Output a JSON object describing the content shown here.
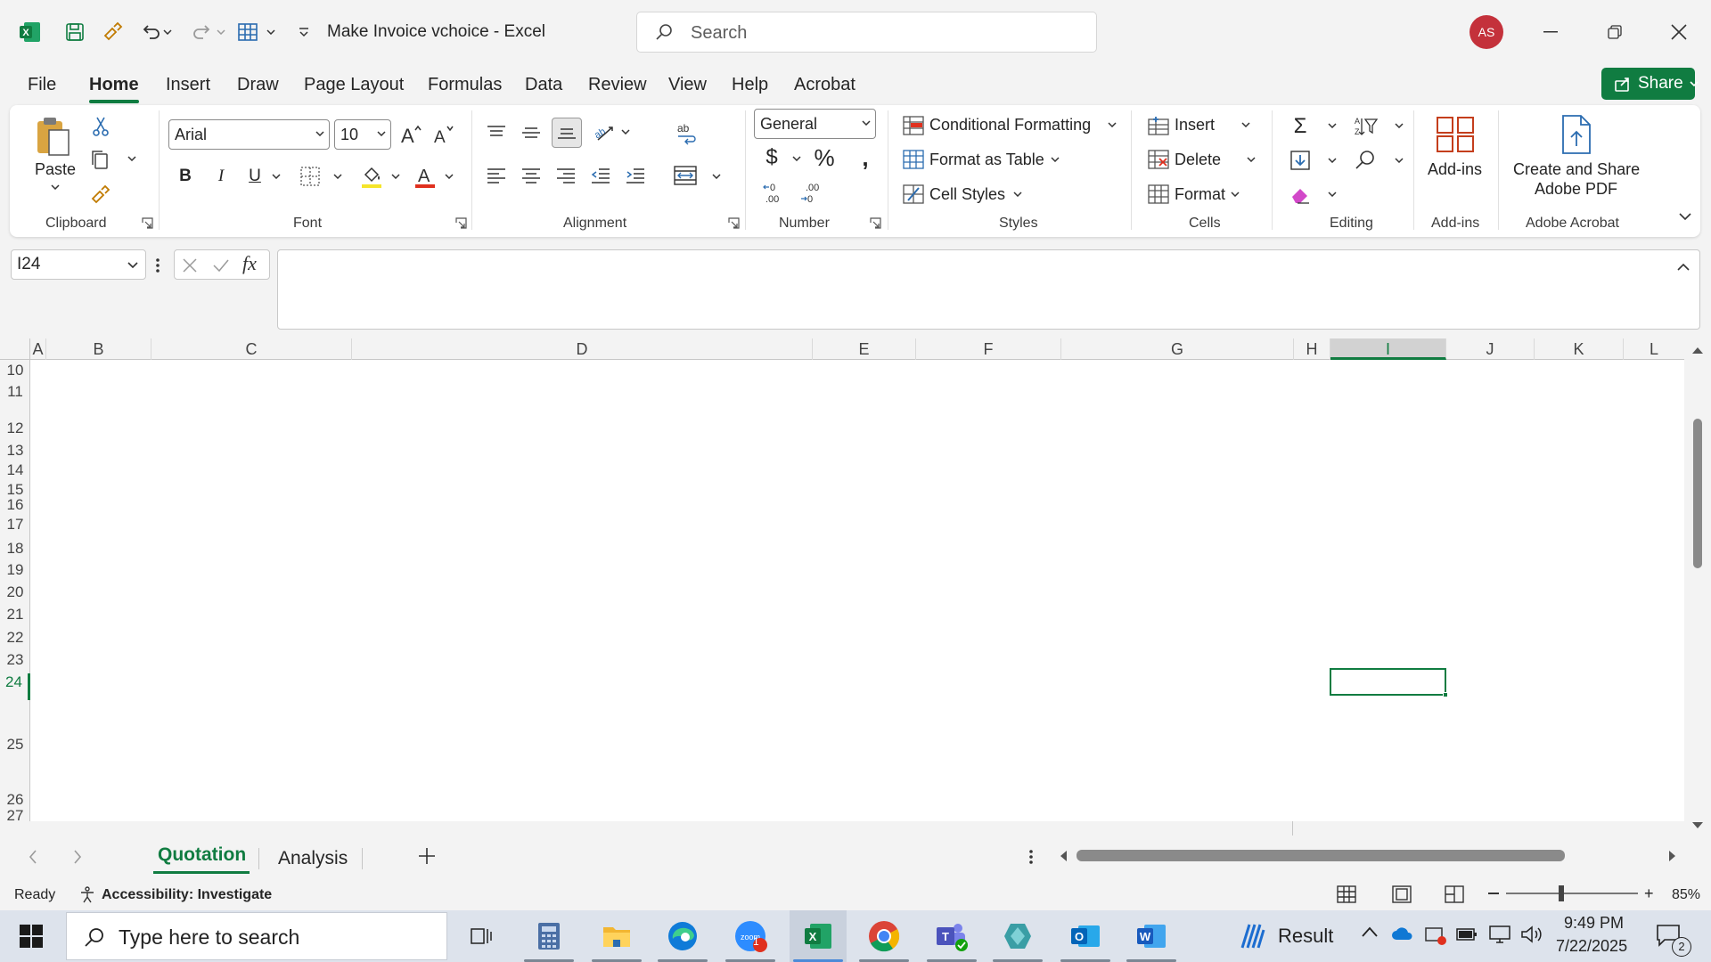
{
  "window": {
    "title": "Make Invoice vchoice  -  Excel",
    "search_placeholder": "Search",
    "avatar_initials": "AS"
  },
  "menu": {
    "tabs": [
      "File",
      "Home",
      "Insert",
      "Draw",
      "Page Layout",
      "Formulas",
      "Data",
      "Review",
      "View",
      "Help",
      "Acrobat"
    ],
    "active": "Home",
    "share_label": "Share"
  },
  "ribbon": {
    "clipboard": {
      "label": "Clipboard",
      "paste": "Paste"
    },
    "font": {
      "label": "Font",
      "family": "Arial",
      "size": "10",
      "bold": "B",
      "italic": "I",
      "underline": "U"
    },
    "alignment": {
      "label": "Alignment"
    },
    "number": {
      "label": "Number",
      "format": "General"
    },
    "styles": {
      "label": "Styles",
      "conditional": "Conditional Formatting",
      "format_table": "Format as Table",
      "cell_styles": "Cell Styles"
    },
    "cells": {
      "label": "Cells",
      "insert": "Insert",
      "delete": "Delete",
      "format": "Format"
    },
    "editing": {
      "label": "Editing"
    },
    "addins": {
      "label": "Add-ins",
      "button": "Add-ins"
    },
    "acrobat": {
      "label": "Adobe Acrobat",
      "button_line1": "Create and Share",
      "button_line2": "Adobe PDF"
    }
  },
  "formula_bar": {
    "name_box": "I24",
    "formula": ""
  },
  "grid": {
    "columns": [
      "A",
      "B",
      "C",
      "D",
      "E",
      "F",
      "G",
      "H",
      "I",
      "J",
      "K",
      "L"
    ],
    "selected_column": "I",
    "rows": [
      "10",
      "11",
      "12",
      "13",
      "14",
      "15",
      "16",
      "17",
      "18",
      "19",
      "20",
      "21",
      "22",
      "23",
      "24",
      "25",
      "26",
      "27"
    ],
    "selected_row": "24",
    "selected_cell": "I24"
  },
  "sheets": {
    "tabs": [
      "Quotation",
      "Analysis"
    ],
    "active": "Quotation"
  },
  "status": {
    "ready": "Ready",
    "accessibility": "Accessibility: Investigate",
    "zoom": "85%"
  },
  "taskbar": {
    "search_placeholder": "Type here to search",
    "weather_label": "Result",
    "time": "9:49 PM",
    "date": "7/22/2025",
    "notification_count": "2",
    "zoom_badge": "1"
  },
  "colors": {
    "accent": "#107c41",
    "avatar": "#c4313b"
  }
}
